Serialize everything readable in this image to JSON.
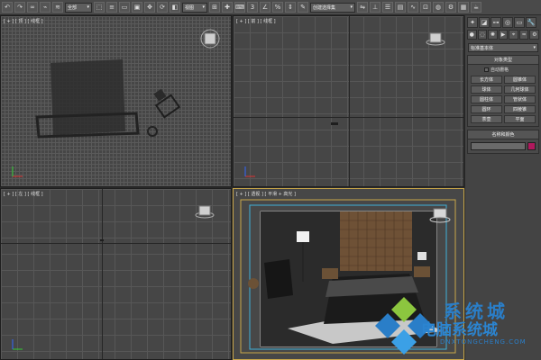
{
  "toolbar": {
    "select_filter": "全部",
    "view_ref": "视图",
    "selection_set": "创建选择集",
    "icons": [
      "undo-icon",
      "redo-icon",
      "link-icon",
      "unlink-icon",
      "bind-icon",
      "filter-dropdown",
      "select-icon",
      "select-name-icon",
      "rect-select-icon",
      "window-icon",
      "move-icon",
      "rotate-icon",
      "scale-icon",
      "ref-dropdown",
      "pivot-icon",
      "select-manip-icon",
      "keyboard-icon",
      "snap-icon",
      "angle-snap-icon",
      "percent-snap-icon",
      "spinner-snap-icon",
      "named-sel-icon",
      "selection-set-dropdown",
      "mirror-icon",
      "align-icon",
      "layer-icon",
      "graphite-icon",
      "curve-icon",
      "schematic-icon",
      "material-icon",
      "render-setup-icon",
      "render-frame-icon",
      "render-icon"
    ]
  },
  "viewports": {
    "top_left": {
      "label": "[ + ] [ 顶 ] [ 线框 ]"
    },
    "top_right": {
      "label": "[ + ] [ 前 ] [ 线框 ]"
    },
    "bottom_left": {
      "label": "[ + ] [ 左 ] [ 线框 ]"
    },
    "bottom_right": {
      "label": "[ + ] [ 透视 ] [ 平滑 + 高光 ]"
    }
  },
  "panel": {
    "primitive_dropdown": "标准基本体",
    "object_type": {
      "title": "对象类型",
      "autogrid": "自动栅格",
      "buttons": [
        "长方体",
        "圆锥体",
        "球体",
        "几何球体",
        "圆柱体",
        "管状体",
        "圆环",
        "四棱锥",
        "茶壶",
        "平面"
      ]
    },
    "name_color": {
      "title": "名称和颜色"
    }
  },
  "watermark": {
    "title": "系统城",
    "subtitle": "电脑系统城",
    "url": "DNXTONGCHENG.COM"
  },
  "colors": {
    "accent_swatch": "#b0195d",
    "wm_blue": "#2a7ec8",
    "wm_green": "#8cc63f"
  }
}
